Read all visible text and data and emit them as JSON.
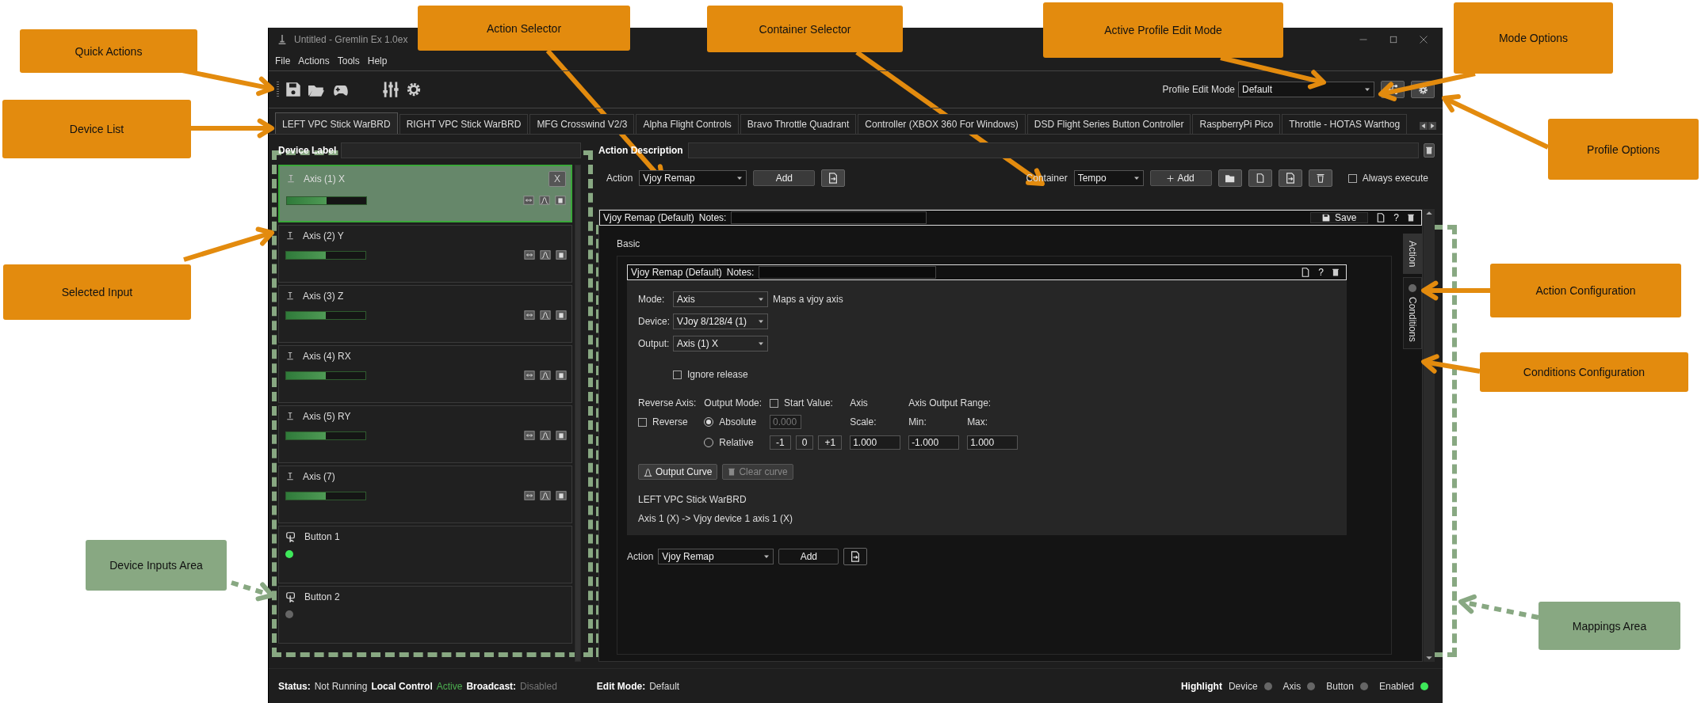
{
  "window": {
    "title": "Untitled - Gremlin Ex 1.0ex"
  },
  "menu": [
    "File",
    "Actions",
    "Tools",
    "Help"
  ],
  "profile_edit_mode": {
    "label": "Profile Edit Mode",
    "value": "Default"
  },
  "device_tabs": [
    {
      "label": "LEFT VPC Stick WarBRD",
      "selected": true
    },
    {
      "label": "RIGHT VPC Stick WarBRD",
      "selected": false
    },
    {
      "label": "MFG Crosswind V2/3",
      "selected": false
    },
    {
      "label": "Alpha Flight Controls",
      "selected": false
    },
    {
      "label": "Bravo Throttle Quadrant",
      "selected": false
    },
    {
      "label": "Controller (XBOX 360 For Windows)",
      "selected": false
    },
    {
      "label": "DSD Flight Series Button Controller",
      "selected": false
    },
    {
      "label": "RaspberryPi Pico",
      "selected": false
    },
    {
      "label": "Throttle - HOTAS Warthog",
      "selected": false
    }
  ],
  "device_label": {
    "label": "Device Label"
  },
  "inputs": [
    {
      "kind": "axis",
      "label": "Axis (1) X",
      "level": 0.5,
      "selected": true,
      "clear": "X"
    },
    {
      "kind": "axis",
      "label": "Axis (2) Y",
      "level": 0.5,
      "selected": false
    },
    {
      "kind": "axis",
      "label": "Axis (3) Z",
      "level": 0.5,
      "selected": false
    },
    {
      "kind": "axis",
      "label": "Axis (4) RX",
      "level": 0.5,
      "selected": false
    },
    {
      "kind": "axis",
      "label": "Axis (5) RY",
      "level": 0.5,
      "selected": false
    },
    {
      "kind": "axis",
      "label": "Axis (7)",
      "level": 0.5,
      "selected": false
    },
    {
      "kind": "button",
      "label": "Button 1",
      "pressed": true,
      "selected": false
    },
    {
      "kind": "button",
      "label": "Button 2",
      "pressed": false,
      "selected": false
    }
  ],
  "action_description": {
    "label": "Action Description"
  },
  "action_bar": {
    "action_label": "Action",
    "action": "Vjoy Remap",
    "add": "Add",
    "container_label": "Container",
    "container": "Tempo",
    "container_add": "Add",
    "always_execute": {
      "label": "Always execute",
      "checked": false
    }
  },
  "mapping": {
    "title": "Vjoy Remap (Default)",
    "notes_label": "Notes:",
    "save": "Save",
    "help": "?",
    "section": "Basic",
    "side_tabs": [
      {
        "label": "Action",
        "selected": true
      },
      {
        "label": "Conditions",
        "selected": false
      }
    ],
    "action": {
      "title": "Vjoy Remap (Default)",
      "notes_label": "Notes:",
      "help": "?",
      "fields": [
        {
          "label": "Mode:",
          "value": "Axis",
          "hint": "Maps a vjoy axis"
        },
        {
          "label": "Device:",
          "value": "VJoy 8/128/4 (1)"
        },
        {
          "label": "Output:",
          "value": "Axis (1) X"
        }
      ],
      "ignore_release": {
        "label": "Ignore release",
        "checked": false
      },
      "reverse_label": "Reverse Axis:",
      "reverse": {
        "label": "Reverse",
        "checked": false
      },
      "output_mode_label": "Output Mode:",
      "modes": [
        {
          "label": "Absolute",
          "selected": true
        },
        {
          "label": "Relative",
          "selected": false
        }
      ],
      "start_value": {
        "label": "Start Value:",
        "checked": false,
        "value": "0.000",
        "disabled": true
      },
      "steps": [
        "-1",
        "0",
        "+1"
      ],
      "scale_heading": "Axis",
      "scale_label": "Scale:",
      "scale": "1.000",
      "range_heading": "Axis Output Range:",
      "min_label": "Min:",
      "min": "-1.000",
      "max_label": "Max:",
      "max": "1.000",
      "curve_buttons": [
        {
          "label": "Output Curve",
          "disabled": false
        },
        {
          "label": "Clear curve",
          "disabled": true
        }
      ],
      "summary": [
        "LEFT VPC Stick WarBRD",
        "Axis 1 (X) -> Vjoy device 1 axis 1 (X)"
      ]
    },
    "add_bar": {
      "label": "Action",
      "action": "Vjoy Remap",
      "add": "Add"
    }
  },
  "status_bar": {
    "items": [
      {
        "label": "Status:",
        "value": "Not Running",
        "color": "#dddddd"
      },
      {
        "label": "Local Control",
        "value": "Active",
        "color": "#4caf50"
      },
      {
        "label": "Broadcast:",
        "value": "Disabled",
        "color": "#777777"
      }
    ],
    "edit_mode": {
      "label": "Edit Mode:",
      "value": "Default"
    },
    "highlight": {
      "label": "Highlight",
      "items": [
        {
          "label": "Device",
          "on": false
        },
        {
          "label": "Axis",
          "on": false
        },
        {
          "label": "Button",
          "on": false
        },
        {
          "label": "Enabled",
          "on": true
        }
      ]
    }
  },
  "annotations": [
    {
      "text": "Quick Actions",
      "kind": "callout"
    },
    {
      "text": "Device List",
      "kind": "callout"
    },
    {
      "text": "Selected Input",
      "kind": "callout"
    },
    {
      "text": "Device Inputs Area",
      "kind": "region"
    },
    {
      "text": "Action Selector",
      "kind": "callout"
    },
    {
      "text": "Container Selector",
      "kind": "callout"
    },
    {
      "text": "Active Profile Edit Mode",
      "kind": "callout"
    },
    {
      "text": "Mode Options",
      "kind": "callout"
    },
    {
      "text": "Profile Options",
      "kind": "callout"
    },
    {
      "text": "Action Configuration",
      "kind": "callout"
    },
    {
      "text": "Conditions Configuration",
      "kind": "callout"
    },
    {
      "text": "Mappings Area",
      "kind": "region"
    }
  ]
}
